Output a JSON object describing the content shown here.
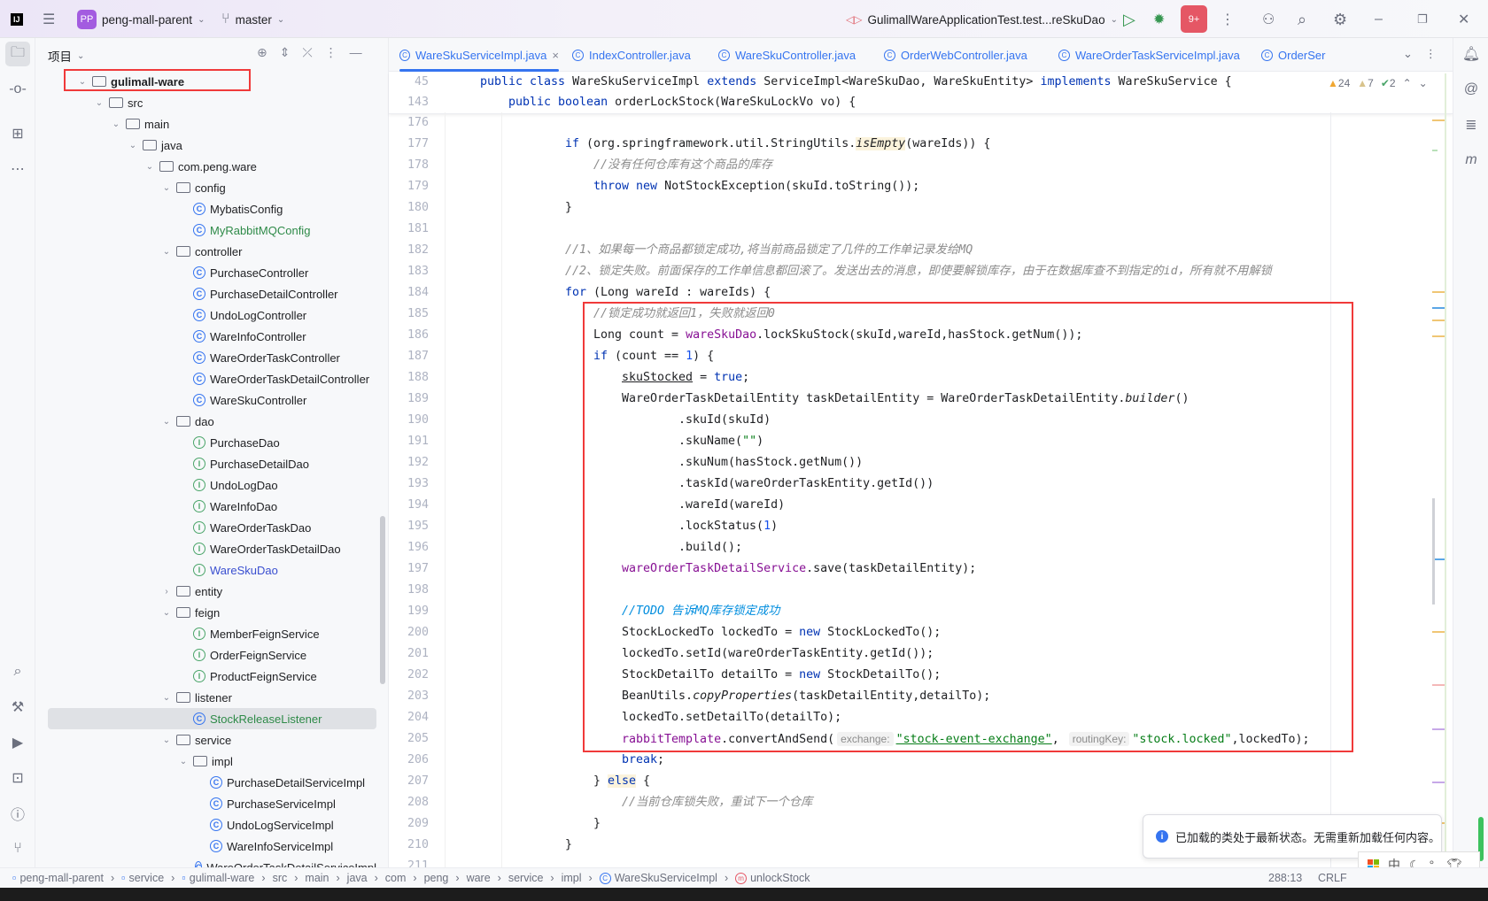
{
  "titlebar": {
    "project_badge": "PP",
    "project": "peng-mall-parent",
    "branch": "master",
    "run_config": "GulimallWareApplicationTest.test...reSkuDao",
    "updates_badge": "9+"
  },
  "project_panel": {
    "title": "项目",
    "tree": [
      {
        "label": "gulimall-ware",
        "level": 0,
        "type": "module",
        "open": true,
        "bold": true
      },
      {
        "label": "src",
        "level": 1,
        "type": "folder",
        "open": true
      },
      {
        "label": "main",
        "level": 2,
        "type": "folder",
        "open": true
      },
      {
        "label": "java",
        "level": 3,
        "type": "folder",
        "open": true
      },
      {
        "label": "com.peng.ware",
        "level": 4,
        "type": "package",
        "open": true
      },
      {
        "label": "config",
        "level": 5,
        "type": "package",
        "open": true
      },
      {
        "label": "MybatisConfig",
        "level": 6,
        "type": "class"
      },
      {
        "label": "MyRabbitMQConfig",
        "level": 6,
        "type": "class",
        "color": "#2e8a48"
      },
      {
        "label": "controller",
        "level": 5,
        "type": "package",
        "open": true
      },
      {
        "label": "PurchaseController",
        "level": 6,
        "type": "class"
      },
      {
        "label": "PurchaseDetailController",
        "level": 6,
        "type": "class"
      },
      {
        "label": "UndoLogController",
        "level": 6,
        "type": "class"
      },
      {
        "label": "WareInfoController",
        "level": 6,
        "type": "class"
      },
      {
        "label": "WareOrderTaskController",
        "level": 6,
        "type": "class"
      },
      {
        "label": "WareOrderTaskDetailController",
        "level": 6,
        "type": "class"
      },
      {
        "label": "WareSkuController",
        "level": 6,
        "type": "class"
      },
      {
        "label": "dao",
        "level": 5,
        "type": "package",
        "open": true
      },
      {
        "label": "PurchaseDao",
        "level": 6,
        "type": "interface"
      },
      {
        "label": "PurchaseDetailDao",
        "level": 6,
        "type": "interface"
      },
      {
        "label": "UndoLogDao",
        "level": 6,
        "type": "interface"
      },
      {
        "label": "WareInfoDao",
        "level": 6,
        "type": "interface"
      },
      {
        "label": "WareOrderTaskDao",
        "level": 6,
        "type": "interface"
      },
      {
        "label": "WareOrderTaskDetailDao",
        "level": 6,
        "type": "interface"
      },
      {
        "label": "WareSkuDao",
        "level": 6,
        "type": "interface",
        "color": "#3a4fd0"
      },
      {
        "label": "entity",
        "level": 5,
        "type": "package",
        "open": false
      },
      {
        "label": "feign",
        "level": 5,
        "type": "package",
        "open": true
      },
      {
        "label": "MemberFeignService",
        "level": 6,
        "type": "interface"
      },
      {
        "label": "OrderFeignService",
        "level": 6,
        "type": "interface"
      },
      {
        "label": "ProductFeignService",
        "level": 6,
        "type": "interface"
      },
      {
        "label": "listener",
        "level": 5,
        "type": "package",
        "open": true
      },
      {
        "label": "StockReleaseListener",
        "level": 6,
        "type": "class",
        "color": "#2e8a48",
        "selected": true
      },
      {
        "label": "service",
        "level": 5,
        "type": "package",
        "open": true
      },
      {
        "label": "impl",
        "level": 6,
        "type": "package",
        "open": true
      },
      {
        "label": "PurchaseDetailServiceImpl",
        "level": 7,
        "type": "class"
      },
      {
        "label": "PurchaseServiceImpl",
        "level": 7,
        "type": "class"
      },
      {
        "label": "UndoLogServiceImpl",
        "level": 7,
        "type": "class"
      },
      {
        "label": "WareInfoServiceImpl",
        "level": 7,
        "type": "class"
      },
      {
        "label": "WareOrderTaskDetailServiceImpl",
        "level": 7,
        "type": "class"
      }
    ]
  },
  "tabs": [
    {
      "label": "WareSkuServiceImpl.java",
      "active": true,
      "close": "×"
    },
    {
      "label": "IndexController.java"
    },
    {
      "label": "WareSkuController.java"
    },
    {
      "label": "OrderWebController.java"
    },
    {
      "label": "WareOrderTaskServiceImpl.java"
    },
    {
      "label": "OrderSer"
    }
  ],
  "inspections": {
    "warnings": "24",
    "weak_warnings": "7",
    "typos": "2"
  },
  "sticky_lines": [
    {
      "n": "45",
      "indent": 0,
      "t": [
        [
          "kw",
          "public class "
        ],
        [
          "",
          "WareSkuServiceImpl "
        ],
        [
          "kw",
          "extends "
        ],
        [
          "",
          "ServiceImpl<WareSkuDao, WareSkuEntity> "
        ],
        [
          "kw",
          "implements "
        ],
        [
          "",
          "WareSkuService {"
        ]
      ]
    },
    {
      "n": "143",
      "indent": 4,
      "t": [
        [
          "kw",
          "public boolean "
        ],
        [
          "",
          "orderLockStock(WareSkuLockVo vo) {"
        ]
      ]
    }
  ],
  "code_lines": [
    {
      "n": "176",
      "indent": 0,
      "t": []
    },
    {
      "n": "177",
      "indent": 12,
      "t": [
        [
          "kw",
          "if"
        ],
        [
          "",
          " (org.springframework.util.StringUtils."
        ],
        [
          "it hl",
          "isEmpty"
        ],
        [
          "",
          "(wareIds)) {"
        ]
      ]
    },
    {
      "n": "178",
      "indent": 16,
      "t": [
        [
          "cm",
          "//没有任何仓库有这个商品的库存"
        ]
      ]
    },
    {
      "n": "179",
      "indent": 16,
      "t": [
        [
          "kw",
          "throw new"
        ],
        [
          "",
          " NotStockException(skuId.toString());"
        ]
      ]
    },
    {
      "n": "180",
      "indent": 12,
      "t": [
        [
          "",
          "}"
        ]
      ]
    },
    {
      "n": "181",
      "indent": 0,
      "t": []
    },
    {
      "n": "182",
      "indent": 12,
      "t": [
        [
          "cm",
          "//1、如果每一个商品都锁定成功,将当前商品锁定了几件的工作单记录发给MQ"
        ]
      ]
    },
    {
      "n": "183",
      "indent": 12,
      "t": [
        [
          "cm",
          "//2、锁定失败。前面保存的工作单信息都回滚了。发送出去的消息，即使要解锁库存，由于在数据库查不到指定的id，所有就不用解锁"
        ]
      ]
    },
    {
      "n": "184",
      "indent": 12,
      "t": [
        [
          "kw",
          "for"
        ],
        [
          "",
          " (Long wareId : wareIds) {"
        ]
      ]
    },
    {
      "n": "185",
      "indent": 16,
      "t": [
        [
          "cm",
          "//锁定成功就返回1，失败就返回0"
        ]
      ]
    },
    {
      "n": "186",
      "indent": 16,
      "t": [
        [
          "",
          "Long count = "
        ],
        [
          "fld",
          "wareSkuDao"
        ],
        [
          "",
          ".lockSkuStock(skuId,wareId,hasStock.getNum());"
        ]
      ]
    },
    {
      "n": "187",
      "indent": 16,
      "t": [
        [
          "kw",
          "if"
        ],
        [
          "",
          " (count == "
        ],
        [
          "num",
          "1"
        ],
        [
          "",
          ") {"
        ]
      ]
    },
    {
      "n": "188",
      "indent": 20,
      "t": [
        [
          "ul",
          "skuStocked"
        ],
        [
          "",
          " = "
        ],
        [
          "kw",
          "true"
        ],
        [
          "",
          ";"
        ]
      ]
    },
    {
      "n": "189",
      "indent": 20,
      "t": [
        [
          "",
          "WareOrderTaskDetailEntity taskDetailEntity = WareOrderTaskDetailEntity."
        ],
        [
          "it",
          "builder"
        ],
        [
          "",
          "()"
        ]
      ]
    },
    {
      "n": "190",
      "indent": 28,
      "t": [
        [
          "",
          ".skuId(skuId)"
        ]
      ]
    },
    {
      "n": "191",
      "indent": 28,
      "t": [
        [
          "",
          ".skuName("
        ],
        [
          "str",
          "\"\""
        ],
        [
          "",
          ")"
        ]
      ]
    },
    {
      "n": "192",
      "indent": 28,
      "t": [
        [
          "",
          ".skuNum(hasStock.getNum())"
        ]
      ]
    },
    {
      "n": "193",
      "indent": 28,
      "t": [
        [
          "",
          ".taskId(wareOrderTaskEntity.getId())"
        ]
      ]
    },
    {
      "n": "194",
      "indent": 28,
      "t": [
        [
          "",
          ".wareId(wareId)"
        ]
      ]
    },
    {
      "n": "195",
      "indent": 28,
      "t": [
        [
          "",
          ".lockStatus("
        ],
        [
          "num",
          "1"
        ],
        [
          "",
          ")"
        ]
      ]
    },
    {
      "n": "196",
      "indent": 28,
      "t": [
        [
          "",
          ".build();"
        ]
      ]
    },
    {
      "n": "197",
      "indent": 20,
      "t": [
        [
          "fld",
          "wareOrderTaskDetailService"
        ],
        [
          "",
          ".save(taskDetailEntity);"
        ]
      ]
    },
    {
      "n": "198",
      "indent": 0,
      "t": []
    },
    {
      "n": "199",
      "indent": 20,
      "t": [
        [
          "todo",
          "//TODO 告诉MQ库存锁定成功"
        ]
      ]
    },
    {
      "n": "200",
      "indent": 20,
      "t": [
        [
          "",
          "StockLockedTo lockedTo = "
        ],
        [
          "kw",
          "new"
        ],
        [
          "",
          " StockLockedTo();"
        ]
      ]
    },
    {
      "n": "201",
      "indent": 20,
      "t": [
        [
          "",
          "lockedTo.setId(wareOrderTaskEntity.getId());"
        ]
      ]
    },
    {
      "n": "202",
      "indent": 20,
      "t": [
        [
          "",
          "StockDetailTo detailTo = "
        ],
        [
          "kw",
          "new"
        ],
        [
          "",
          " StockDetailTo();"
        ]
      ]
    },
    {
      "n": "203",
      "indent": 20,
      "t": [
        [
          "",
          "BeanUtils."
        ],
        [
          "it",
          "copyProperties"
        ],
        [
          "",
          "(taskDetailEntity,detailTo);"
        ]
      ]
    },
    {
      "n": "204",
      "indent": 20,
      "t": [
        [
          "",
          "lockedTo.setDetailTo(detailTo);"
        ]
      ]
    },
    {
      "n": "205",
      "indent": 20,
      "t": [
        [
          "fld",
          "rabbitTemplate"
        ],
        [
          "",
          ".convertAndSend("
        ],
        [
          "hint",
          "exchange:"
        ],
        [
          "str ul",
          "\"stock-event-exchange\""
        ],
        [
          "",
          ", "
        ],
        [
          "hint",
          "routingKey:"
        ],
        [
          "str",
          "\"stock.locked\""
        ],
        [
          "",
          ",lockedTo);"
        ]
      ]
    },
    {
      "n": "206",
      "indent": 20,
      "t": [
        [
          "kw",
          "break"
        ],
        [
          "",
          ";"
        ]
      ]
    },
    {
      "n": "207",
      "indent": 16,
      "t": [
        [
          "",
          "} "
        ],
        [
          "kw hl",
          "else"
        ],
        [
          "",
          " {"
        ]
      ]
    },
    {
      "n": "208",
      "indent": 20,
      "t": [
        [
          "cm",
          "//当前仓库锁失败，重试下一个仓库"
        ]
      ]
    },
    {
      "n": "209",
      "indent": 16,
      "t": [
        [
          "",
          "}"
        ]
      ]
    },
    {
      "n": "210",
      "indent": 12,
      "t": [
        [
          "",
          "}"
        ]
      ]
    },
    {
      "n": "211",
      "indent": 0,
      "t": []
    }
  ],
  "notification": {
    "text": "已加载的类处于最新状态。无需重新加载任何内容。"
  },
  "statusbar": {
    "breadcrumbs": [
      "peng-mall-parent",
      "service",
      "gulimall-ware",
      "src",
      "main",
      "java",
      "com",
      "peng",
      "ware",
      "service",
      "impl",
      "WareSkuServiceImpl",
      "unlockStock"
    ],
    "position": "288:13",
    "line_ending": "CRLF"
  },
  "ime": {
    "lang": "中"
  },
  "colors": {
    "accent": "#3574f0",
    "highlight_box": "#f03a3a",
    "keyword": "#0033b3",
    "string": "#067d17",
    "comment": "#8c8c8c"
  }
}
